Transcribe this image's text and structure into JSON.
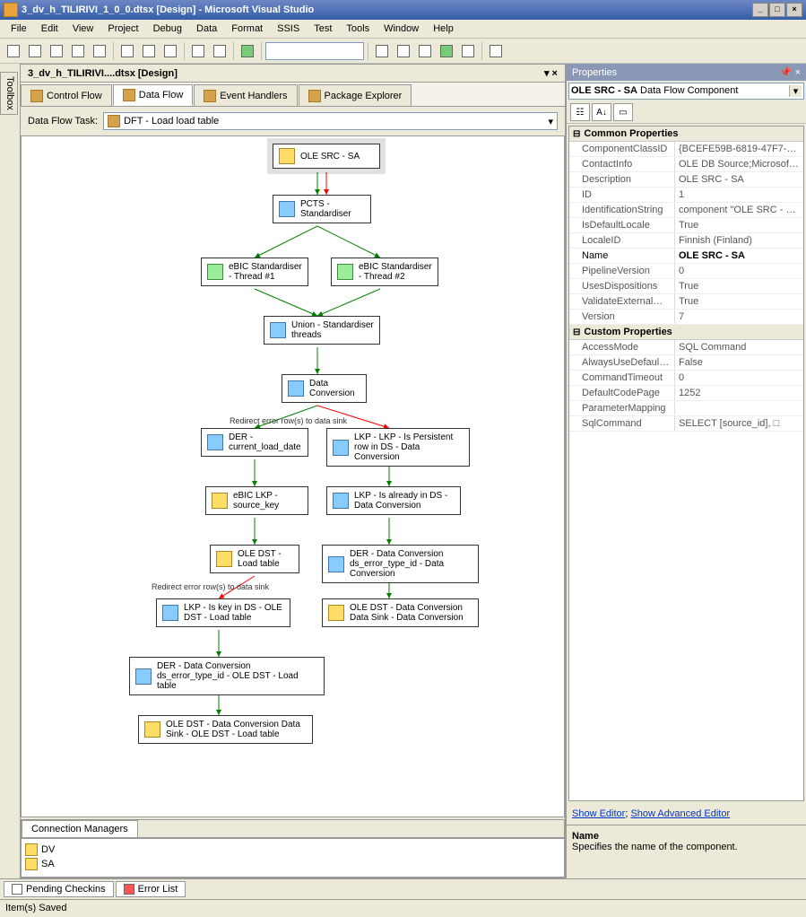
{
  "window": {
    "title": "3_dv_h_TILIRIVI_1_0_0.dtsx [Design] - Microsoft Visual Studio"
  },
  "menu": {
    "file": "File",
    "edit": "Edit",
    "view": "View",
    "project": "Project",
    "debug": "Debug",
    "data": "Data",
    "format": "Format",
    "ssis": "SSIS",
    "test": "Test",
    "tools": "Tools",
    "window": "Window",
    "help": "Help"
  },
  "sidebar": {
    "toolbox": "Toolbox"
  },
  "doc_tab": "3_dv_h_TILIRIVI....dtsx [Design]",
  "design_tabs": {
    "control_flow": "Control Flow",
    "data_flow": "Data Flow",
    "event_handlers": "Event Handlers",
    "package_explorer": "Package Explorer"
  },
  "task_label": "Data Flow Task:",
  "task_value": "DFT - Load load table",
  "shapes": {
    "src": "OLE SRC - SA",
    "pcts": "PCTS - Standardiser",
    "ebic1": "eBIC Standardiser - Thread #1",
    "ebic2": "eBIC Standardiser - Thread #2",
    "union": "Union - Standardiser threads",
    "dconv": "Data Conversion",
    "der_load": "DER - current_load_date",
    "lkp_pers": "LKP - LKP - Is Persistent row in DS - Data Conversion",
    "ebic_lkp": "eBIC LKP - source_key",
    "lkp_already": "LKP - Is already in DS - Data Conversion",
    "ole_load": "OLE DST - Load table",
    "der_err": "DER - Data Conversion ds_error_type_id - Data Conversion",
    "lkp_key": "LKP - Is key in DS - OLE DST - Load table",
    "ole_sink": "OLE DST - Data Conversion Data Sink - Data Conversion",
    "der_ole": "DER - Data Conversion ds_error_type_id - OLE DST - Load table",
    "ole_final": "OLE DST - Data Conversion Data Sink - OLE DST - Load table"
  },
  "edge_labels": {
    "err1": "Redirect error row(s) to data sink",
    "err2": "Redirect error row(s) to data sink"
  },
  "connections": {
    "tab": "Connection Managers",
    "dv": "DV",
    "sa": "SA"
  },
  "properties": {
    "panel_title": "Properties",
    "selected": "OLE SRC - SA",
    "selected_type": "Data Flow Component",
    "cat_common": "Common Properties",
    "cat_custom": "Custom Properties",
    "rows": [
      {
        "name": "ComponentClassID",
        "value": "{BCEFE59B-6819-47F7-A12",
        "editable": false
      },
      {
        "name": "ContactInfo",
        "value": "OLE DB Source;Microsoft C",
        "editable": false
      },
      {
        "name": "Description",
        "value": "OLE SRC - SA",
        "editable": true
      },
      {
        "name": "ID",
        "value": "1",
        "editable": false
      },
      {
        "name": "IdentificationString",
        "value": "component \"OLE SRC - SA\"",
        "editable": false
      },
      {
        "name": "IsDefaultLocale",
        "value": "True",
        "editable": false
      },
      {
        "name": "LocaleID",
        "value": "Finnish (Finland)",
        "editable": true
      },
      {
        "name": "Name",
        "value": "OLE SRC - SA",
        "editable": true,
        "bold": true
      },
      {
        "name": "PipelineVersion",
        "value": "0",
        "editable": false
      },
      {
        "name": "UsesDispositions",
        "value": "True",
        "editable": false
      },
      {
        "name": "ValidateExternalMetadata",
        "value": "True",
        "editable": true
      },
      {
        "name": "Version",
        "value": "7",
        "editable": false
      }
    ],
    "custom_rows": [
      {
        "name": "AccessMode",
        "value": "SQL Command"
      },
      {
        "name": "AlwaysUseDefaultCodePage",
        "value": "False"
      },
      {
        "name": "CommandTimeout",
        "value": "0"
      },
      {
        "name": "DefaultCodePage",
        "value": "1252"
      },
      {
        "name": "ParameterMapping",
        "value": ""
      },
      {
        "name": "SqlCommand",
        "value": "SELECT   [source_id], □"
      }
    ],
    "links": {
      "show_editor": "Show Editor",
      "show_advanced": "Show Advanced Editor"
    },
    "help_title": "Name",
    "help_text": "Specifies the name of the component."
  },
  "bottom_tabs": {
    "pending": "Pending Checkins",
    "errors": "Error List"
  },
  "status": "Item(s) Saved"
}
